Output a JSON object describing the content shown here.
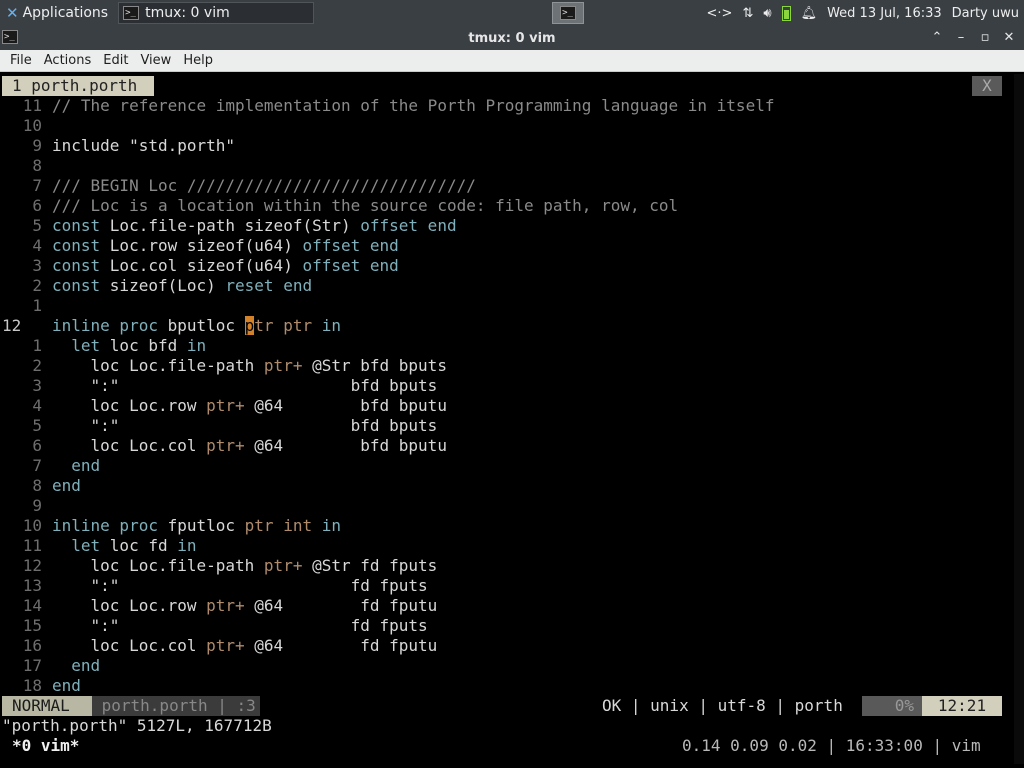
{
  "panel": {
    "applications_label": "Applications",
    "task_label": "tmux: 0 vim",
    "clock": "Wed 13 Jul, 16:33",
    "user": "Darty uwu",
    "network_icon": "network-icon",
    "transfer_icon": "transfer-arrows-icon",
    "volume_icon": "volume-icon",
    "battery_icon": "battery-icon",
    "notifications_icon": "bell-icon"
  },
  "window": {
    "title": "tmux: 0 vim",
    "buttons": [
      "collapse",
      "minimize",
      "maximize",
      "close"
    ]
  },
  "menubar": {
    "items": [
      "File",
      "Actions",
      "Edit",
      "View",
      "Help"
    ]
  },
  "vim": {
    "tab_label": "1 porth.porth",
    "tab_close": "X",
    "lines": [
      {
        "num": "11",
        "tokens": [
          {
            "t": "// The reference implementation of the Porth Programming language in itself",
            "c": "c-com"
          }
        ]
      },
      {
        "num": "10",
        "tokens": []
      },
      {
        "num": "9",
        "tokens": [
          {
            "t": "include \"std.porth\"",
            "c": "c-str"
          }
        ]
      },
      {
        "num": "8",
        "tokens": []
      },
      {
        "num": "7",
        "tokens": [
          {
            "t": "/// BEGIN Loc //////////////////////////////",
            "c": "c-com"
          }
        ]
      },
      {
        "num": "6",
        "tokens": [
          {
            "t": "/// Loc is a location within the source code: file path, row, col",
            "c": "c-com"
          }
        ]
      },
      {
        "num": "5",
        "tokens": [
          {
            "t": "const ",
            "c": "c-kw"
          },
          {
            "t": "Loc.file-path sizeof(Str) ",
            "c": ""
          },
          {
            "t": "offset end",
            "c": "c-kw"
          }
        ]
      },
      {
        "num": "4",
        "tokens": [
          {
            "t": "const ",
            "c": "c-kw"
          },
          {
            "t": "Loc.row sizeof(u64) ",
            "c": ""
          },
          {
            "t": "offset end",
            "c": "c-kw"
          }
        ]
      },
      {
        "num": "3",
        "tokens": [
          {
            "t": "const ",
            "c": "c-kw"
          },
          {
            "t": "Loc.col sizeof(u64) ",
            "c": ""
          },
          {
            "t": "offset end",
            "c": "c-kw"
          }
        ]
      },
      {
        "num": "2",
        "tokens": [
          {
            "t": "const ",
            "c": "c-kw"
          },
          {
            "t": "sizeof(Loc) ",
            "c": ""
          },
          {
            "t": "reset end",
            "c": "c-kw"
          }
        ]
      },
      {
        "num": "1",
        "tokens": []
      },
      {
        "num": "12",
        "current": true,
        "tokens": [
          {
            "t": "inline proc ",
            "c": "c-kw"
          },
          {
            "t": "bputloc ",
            "c": ""
          },
          {
            "t": "p",
            "c": "cursor"
          },
          {
            "t": "tr ptr ",
            "c": "c-op"
          },
          {
            "t": "in",
            "c": "c-kw"
          }
        ]
      },
      {
        "num": "1",
        "tokens": [
          {
            "t": "  let ",
            "c": "c-kw"
          },
          {
            "t": "loc bfd ",
            "c": ""
          },
          {
            "t": "in",
            "c": "c-kw"
          }
        ]
      },
      {
        "num": "2",
        "tokens": [
          {
            "t": "    loc Loc.file-path ",
            "c": ""
          },
          {
            "t": "ptr+",
            "c": "c-op"
          },
          {
            "t": " @Str bfd bputs",
            "c": ""
          }
        ]
      },
      {
        "num": "3",
        "tokens": [
          {
            "t": "    \":\"                        bfd bputs",
            "c": ""
          }
        ]
      },
      {
        "num": "4",
        "tokens": [
          {
            "t": "    loc Loc.row ",
            "c": ""
          },
          {
            "t": "ptr+",
            "c": "c-op"
          },
          {
            "t": " @64        bfd bputu",
            "c": ""
          }
        ]
      },
      {
        "num": "5",
        "tokens": [
          {
            "t": "    \":\"                        bfd bputs",
            "c": ""
          }
        ]
      },
      {
        "num": "6",
        "tokens": [
          {
            "t": "    loc Loc.col ",
            "c": ""
          },
          {
            "t": "ptr+",
            "c": "c-op"
          },
          {
            "t": " @64        bfd bputu",
            "c": ""
          }
        ]
      },
      {
        "num": "7",
        "tokens": [
          {
            "t": "  end",
            "c": "c-kw"
          }
        ]
      },
      {
        "num": "8",
        "tokens": [
          {
            "t": "end",
            "c": "c-kw"
          }
        ]
      },
      {
        "num": "9",
        "tokens": []
      },
      {
        "num": "10",
        "tokens": [
          {
            "t": "inline proc ",
            "c": "c-kw"
          },
          {
            "t": "fputloc ",
            "c": ""
          },
          {
            "t": "ptr int ",
            "c": "c-op"
          },
          {
            "t": "in",
            "c": "c-kw"
          }
        ]
      },
      {
        "num": "11",
        "tokens": [
          {
            "t": "  let ",
            "c": "c-kw"
          },
          {
            "t": "loc fd ",
            "c": ""
          },
          {
            "t": "in",
            "c": "c-kw"
          }
        ]
      },
      {
        "num": "12",
        "tokens": [
          {
            "t": "    loc Loc.file-path ",
            "c": ""
          },
          {
            "t": "ptr+",
            "c": "c-op"
          },
          {
            "t": " @Str fd fputs",
            "c": ""
          }
        ]
      },
      {
        "num": "13",
        "tokens": [
          {
            "t": "    \":\"                        fd fputs",
            "c": ""
          }
        ]
      },
      {
        "num": "14",
        "tokens": [
          {
            "t": "    loc Loc.row ",
            "c": ""
          },
          {
            "t": "ptr+",
            "c": "c-op"
          },
          {
            "t": " @64        fd fputu",
            "c": ""
          }
        ]
      },
      {
        "num": "15",
        "tokens": [
          {
            "t": "    \":\"                        fd fputs",
            "c": ""
          }
        ]
      },
      {
        "num": "16",
        "tokens": [
          {
            "t": "    loc Loc.col ",
            "c": ""
          },
          {
            "t": "ptr+",
            "c": "c-op"
          },
          {
            "t": " @64        fd fputu",
            "c": ""
          }
        ]
      },
      {
        "num": "17",
        "tokens": [
          {
            "t": "  end",
            "c": "c-kw"
          }
        ]
      },
      {
        "num": "18",
        "tokens": [
          {
            "t": "end",
            "c": "c-kw"
          }
        ]
      }
    ],
    "statusline": {
      "mode": "NORMAL",
      "file": " porth.porth | :3",
      "info": "OK | unix | utf-8 | porth",
      "percent": "0%",
      "position": "12:21"
    },
    "cmdline": "\"porth.porth\" 5127L, 167712B"
  },
  "tmux": {
    "window": "*0 vim*",
    "right": "0.14 0.09 0.02 | 16:33:00 | vim"
  }
}
